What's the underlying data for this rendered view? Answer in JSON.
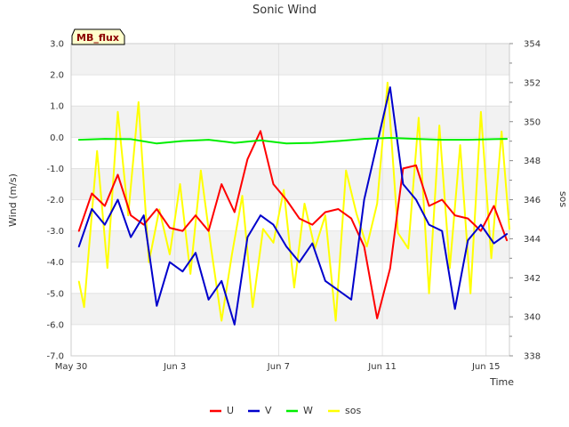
{
  "chart_data": {
    "type": "line",
    "title": "Sonic Wind",
    "badge": "MB_flux",
    "xlabel": "Time",
    "ylabel": "Wind (m/s)",
    "y2label": "sos",
    "x_range": [
      "May 30",
      "Jun 16.9"
    ],
    "ylim": [
      -7.0,
      3.0
    ],
    "y2lim": [
      338,
      354
    ],
    "yticks": [
      "3.0",
      "2.0",
      "1.0",
      "0.0",
      "-1.0",
      "-2.0",
      "-3.0",
      "-4.0",
      "-5.0",
      "-6.0",
      "-7.0"
    ],
    "y2ticks": [
      "354",
      "352",
      "350",
      "348",
      "346",
      "344",
      "342",
      "340",
      "338"
    ],
    "xticks": [
      {
        "label": "May 30",
        "day": 0
      },
      {
        "label": "Jun 3",
        "day": 4
      },
      {
        "label": "Jun 7",
        "day": 8
      },
      {
        "label": "Jun 11",
        "day": 12
      },
      {
        "label": "Jun 15",
        "day": 16
      }
    ],
    "grid": true,
    "legend_position": "bottom-center",
    "legend": [
      {
        "name": "U",
        "color": "#ff0000"
      },
      {
        "name": "V",
        "color": "#0000cc"
      },
      {
        "name": "W",
        "color": "#00ee00"
      },
      {
        "name": "sos",
        "color": "#ffff00"
      }
    ],
    "series": [
      {
        "name": "U",
        "axis": "left",
        "color": "#ff0000",
        "x": [
          0.3,
          0.8,
          1.3,
          1.8,
          2.3,
          2.8,
          3.3,
          3.8,
          4.3,
          4.8,
          5.3,
          5.8,
          6.3,
          6.8,
          7.3,
          7.8,
          8.3,
          8.8,
          9.3,
          9.8,
          10.3,
          10.8,
          11.3,
          11.8,
          12.3,
          12.8,
          13.3,
          13.8,
          14.3,
          14.8,
          15.3,
          15.8,
          16.3,
          16.8
        ],
        "values": [
          -3.0,
          -1.8,
          -2.2,
          -1.2,
          -2.5,
          -2.8,
          -2.3,
          -2.9,
          -3.0,
          -2.5,
          -3.0,
          -1.5,
          -2.4,
          -0.7,
          0.2,
          -1.5,
          -2.0,
          -2.6,
          -2.8,
          -2.4,
          -2.3,
          -2.6,
          -3.5,
          -5.8,
          -4.2,
          -1.0,
          -0.9,
          -2.2,
          -2.0,
          -2.5,
          -2.6,
          -3.0,
          -2.2,
          -3.3
        ]
      },
      {
        "name": "V",
        "axis": "left",
        "color": "#0000cc",
        "x": [
          0.3,
          0.8,
          1.3,
          1.8,
          2.3,
          2.8,
          3.3,
          3.8,
          4.3,
          4.8,
          5.3,
          5.8,
          6.3,
          6.8,
          7.3,
          7.8,
          8.3,
          8.8,
          9.3,
          9.8,
          10.3,
          10.8,
          11.3,
          11.8,
          12.3,
          12.8,
          13.3,
          13.8,
          14.3,
          14.8,
          15.3,
          15.8,
          16.3,
          16.8
        ],
        "values": [
          -3.5,
          -2.3,
          -2.8,
          -2.0,
          -3.2,
          -2.5,
          -5.4,
          -4.0,
          -4.3,
          -3.7,
          -5.2,
          -4.6,
          -6.0,
          -3.2,
          -2.5,
          -2.8,
          -3.5,
          -4.0,
          -3.4,
          -4.6,
          -4.9,
          -5.2,
          -2.0,
          -0.2,
          1.6,
          -1.5,
          -2.0,
          -2.8,
          -3.0,
          -5.5,
          -3.3,
          -2.8,
          -3.4,
          -3.1
        ]
      },
      {
        "name": "W",
        "axis": "left",
        "color": "#00ee00",
        "x": [
          0.3,
          1.3,
          2.3,
          3.3,
          4.3,
          5.3,
          6.3,
          7.3,
          8.3,
          9.3,
          10.3,
          11.3,
          12.3,
          13.3,
          14.3,
          15.3,
          16.3,
          16.8
        ],
        "values": [
          -0.08,
          -0.05,
          -0.06,
          -0.2,
          -0.12,
          -0.08,
          -0.18,
          -0.1,
          -0.2,
          -0.18,
          -0.12,
          -0.05,
          -0.02,
          -0.05,
          -0.08,
          -0.08,
          -0.06,
          -0.05
        ]
      },
      {
        "name": "sos",
        "axis": "right",
        "color": "#ffff00",
        "x": [
          0.3,
          0.5,
          1.0,
          1.4,
          1.8,
          2.2,
          2.6,
          3.0,
          3.4,
          3.8,
          4.2,
          4.6,
          5.0,
          5.4,
          5.8,
          6.2,
          6.6,
          7.0,
          7.4,
          7.8,
          8.2,
          8.6,
          9.0,
          9.4,
          9.8,
          10.2,
          10.6,
          11.0,
          11.4,
          11.8,
          12.2,
          12.6,
          13.0,
          13.4,
          13.8,
          14.2,
          14.6,
          15.0,
          15.4,
          15.8,
          16.2,
          16.6,
          16.9
        ],
        "values": [
          341.8,
          340.5,
          348.5,
          342.5,
          350.5,
          345.2,
          351.0,
          342.8,
          345.5,
          343.2,
          346.8,
          342.2,
          347.5,
          343.5,
          339.8,
          343.2,
          346.2,
          340.5,
          344.5,
          343.8,
          346.5,
          341.5,
          345.8,
          343.5,
          345.2,
          339.8,
          347.5,
          345.3,
          343.6,
          345.8,
          352.0,
          344.3,
          343.5,
          350.2,
          341.2,
          349.8,
          342.5,
          348.8,
          341.2,
          350.5,
          343.0,
          349.5,
          344.5
        ]
      }
    ]
  }
}
